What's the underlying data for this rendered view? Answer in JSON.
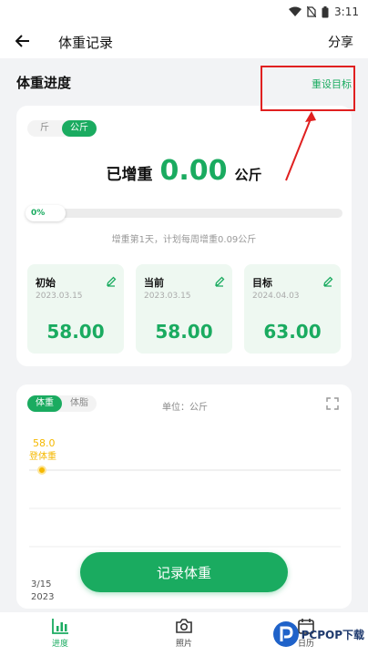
{
  "status_bar": {
    "time": "3:11"
  },
  "header": {
    "title": "体重记录",
    "share_label": "分享"
  },
  "progress_section": {
    "title": "体重进度",
    "reset_goal_label": "重设目标",
    "unit_options": [
      "斤",
      "公斤"
    ],
    "active_unit_index": 1,
    "gain_label": "已增重",
    "gain_value": "0.00",
    "gain_unit": "公斤",
    "progress_label": "0%",
    "progress_fraction": 0.0,
    "plan_text": "增重第1天，计划每周增重0.09公斤",
    "stats": [
      {
        "title": "初始",
        "date": "2023.03.15",
        "value": "58.00"
      },
      {
        "title": "当前",
        "date": "2023.03.15",
        "value": "58.00"
      },
      {
        "title": "目标",
        "date": "2024.04.03",
        "value": "63.00"
      }
    ]
  },
  "chart_section": {
    "metric_options": [
      "体重",
      "体脂"
    ],
    "active_metric_index": 0,
    "unit_text": "单位：公斤",
    "chart_data": {
      "type": "line",
      "series": [
        {
          "name": "",
          "points": [
            {
              "x": "3/15",
              "y": 58.0
            }
          ]
        }
      ],
      "point_label_value": "58.0",
      "point_label_tag": "登体重",
      "x_tick_labels": [
        "3/15"
      ],
      "x_year_label": "2023"
    }
  },
  "record_button_label": "记录体重",
  "bottom_nav": [
    {
      "label": "进度",
      "icon": "chart-bar-icon",
      "active": true
    },
    {
      "label": "照片",
      "icon": "camera-icon",
      "active": false
    },
    {
      "label": "日历",
      "icon": "calendar-icon",
      "active": false
    }
  ],
  "watermark": {
    "text": "PCPOP下载"
  },
  "colors": {
    "accent": "#1aab60",
    "annotation": "#e02020",
    "point": "#f5b800"
  }
}
